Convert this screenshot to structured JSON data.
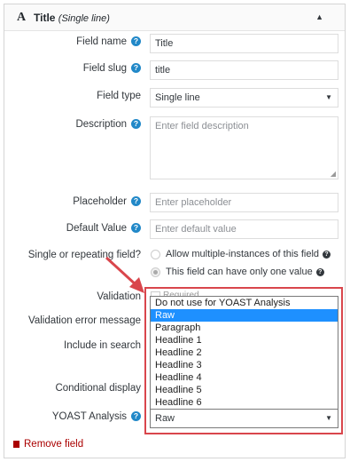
{
  "header": {
    "icon": "A",
    "title": "Title",
    "subtitle": "(Single line)"
  },
  "fields": {
    "field_name": {
      "label": "Field name",
      "value": "Title"
    },
    "field_slug": {
      "label": "Field slug",
      "value": "title"
    },
    "field_type": {
      "label": "Field type",
      "value": "Single line"
    },
    "description": {
      "label": "Description",
      "placeholder": "Enter field description"
    },
    "placeholder": {
      "label": "Placeholder",
      "placeholder": "Enter placeholder"
    },
    "default_value": {
      "label": "Default Value",
      "placeholder": "Enter default value"
    },
    "repeating": {
      "label": "Single or repeating field?",
      "options": [
        "Allow multiple-instances of this field",
        "This field can have only one value"
      ]
    },
    "validation": {
      "label": "Validation",
      "checkbox_label": "Required"
    },
    "validation_error": {
      "label": "Validation error message"
    },
    "include_in_search": {
      "label": "Include in search"
    },
    "conditional_display": {
      "label": "Conditional display"
    },
    "yoast": {
      "label": "YOAST Analysis",
      "value": "Raw",
      "options": [
        "Do not use for YOAST Analysis",
        "Raw",
        "Paragraph",
        "Headline 1",
        "Headline 2",
        "Headline 3",
        "Headline 4",
        "Headline 5",
        "Headline 6"
      ]
    }
  },
  "help_glyph": "?",
  "remove_label": "Remove field",
  "colors": {
    "help": "#2188c8",
    "highlight": "#1e90ff",
    "annotation": "#d9464c",
    "remove": "#aa0000"
  }
}
